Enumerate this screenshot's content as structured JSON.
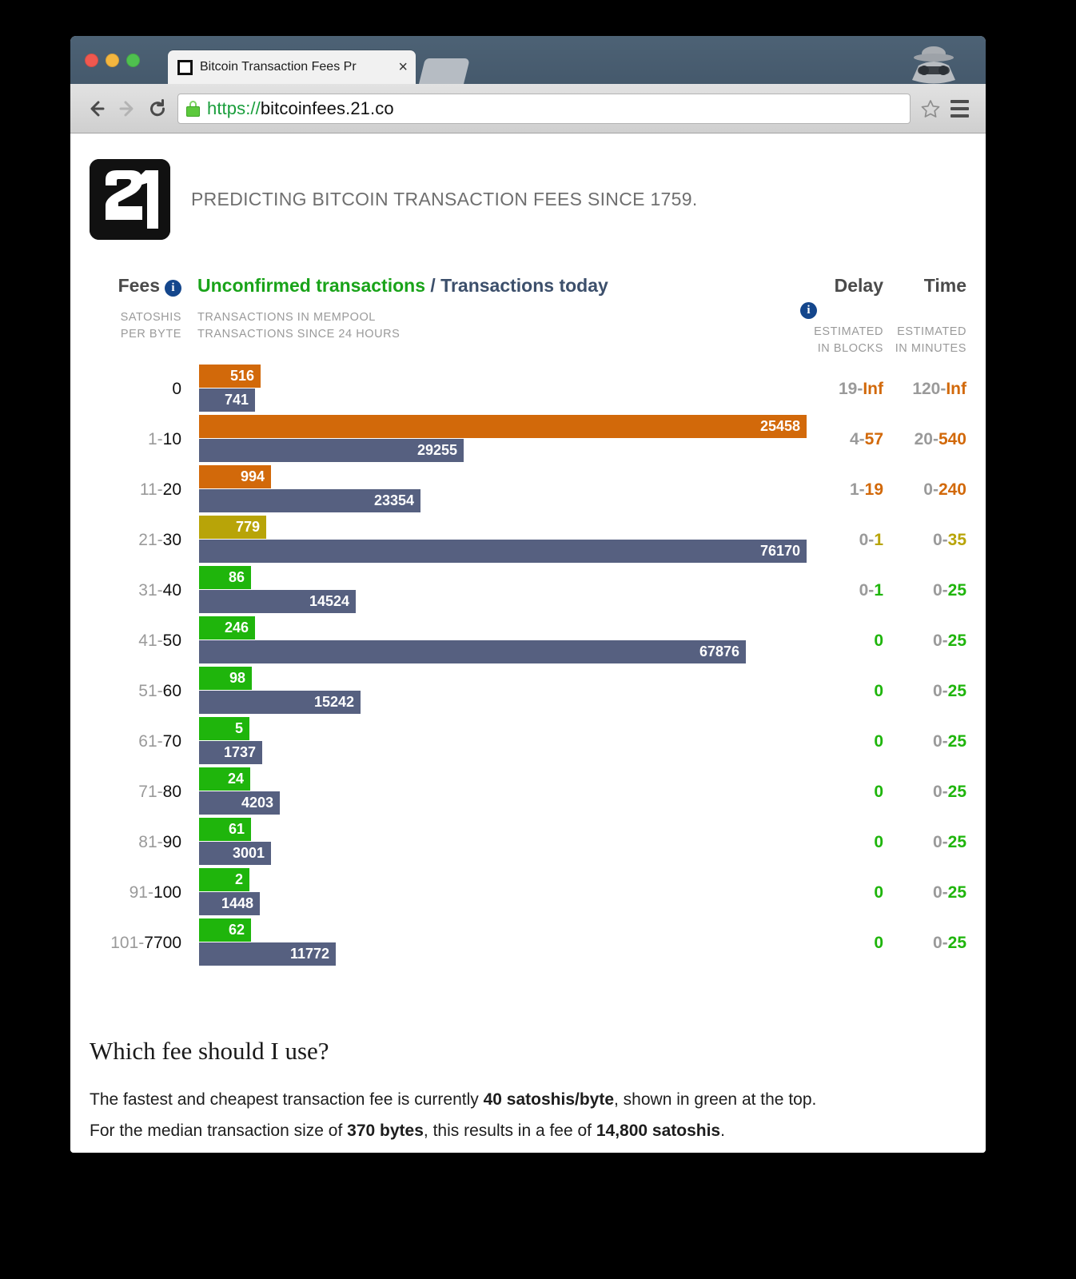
{
  "browser": {
    "tab_title": "Bitcoin Transaction Fees Pr",
    "tab_close_glyph": "×",
    "url_scheme": "https://",
    "url_host": "bitcoinfees.21.co",
    "back_label": "Back",
    "forward_label": "Forward",
    "reload_label": "Reload",
    "bookmark_label": "Bookmark this page",
    "menu_label": "Customize and control",
    "incognito_label": "Incognito mode"
  },
  "site": {
    "logo_text": "21",
    "tagline": "PREDICTING BITCOIN TRANSACTION FEES SINCE 1759."
  },
  "headers": {
    "fees": "Fees",
    "unconfirmed": "Unconfirmed transactions",
    "separator": " / ",
    "today": "Transactions today",
    "delay": "Delay",
    "time": "Time",
    "fees_sub_1": "SATOSHIS",
    "fees_sub_2": "PER BYTE",
    "chart_sub_1": "TRANSACTIONS IN MEMPOOL",
    "chart_sub_2": "TRANSACTIONS SINCE 24 HOURS",
    "delay_sub_1": "ESTIMATED",
    "delay_sub_2": "IN BLOCKS",
    "time_sub_1": "ESTIMATED",
    "time_sub_2": "IN MINUTES"
  },
  "colors": {
    "orange": "#d2690a",
    "olive": "#b8a408",
    "green": "#1fb50c",
    "slate": "#566080",
    "gray": "#9a9a9a",
    "brand_blue": "#14468c"
  },
  "chart_data": {
    "type": "bar",
    "title": "Unconfirmed transactions / Transactions today",
    "xlabel": "",
    "ylabel": "Satoshis per byte",
    "grid": false,
    "legend": [
      "Transactions in mempool",
      "Transactions since 24 hours"
    ],
    "categories": [
      "0",
      "1-10",
      "11-20",
      "21-30",
      "31-40",
      "41-50",
      "51-60",
      "61-70",
      "71-80",
      "81-90",
      "91-100",
      "101-7700"
    ],
    "series": [
      {
        "name": "Transactions in mempool",
        "values": [
          516,
          25458,
          994,
          779,
          86,
          246,
          98,
          5,
          24,
          61,
          2,
          62
        ],
        "max": 25458
      },
      {
        "name": "Transactions since 24 hours",
        "values": [
          741,
          29255,
          23354,
          76170,
          14524,
          67876,
          15242,
          1737,
          4203,
          3001,
          1448,
          11772
        ],
        "max": 76170
      }
    ]
  },
  "rows": [
    {
      "fee_lead": "",
      "fee_tail": "0",
      "mempool": "516",
      "mempool_color": "#d2690a",
      "mempool_value": 516,
      "daily": "741",
      "daily_value": 741,
      "delay_lo": "19-",
      "delay_hi": "Inf",
      "delay_color": "#d2690a",
      "time_lo": "120-",
      "time_hi": "Inf",
      "time_color": "#d2690a"
    },
    {
      "fee_lead": "1-",
      "fee_tail": "10",
      "mempool": "25458",
      "mempool_color": "#d2690a",
      "mempool_value": 25458,
      "daily": "29255",
      "daily_value": 29255,
      "delay_lo": "4-",
      "delay_hi": "57",
      "delay_color": "#d2690a",
      "time_lo": "20-",
      "time_hi": "540",
      "time_color": "#d2690a"
    },
    {
      "fee_lead": "11-",
      "fee_tail": "20",
      "mempool": "994",
      "mempool_color": "#d2690a",
      "mempool_value": 994,
      "daily": "23354",
      "daily_value": 23354,
      "delay_lo": "1-",
      "delay_hi": "19",
      "delay_color": "#d2690a",
      "time_lo": "0-",
      "time_hi": "240",
      "time_color": "#d2690a"
    },
    {
      "fee_lead": "21-",
      "fee_tail": "30",
      "mempool": "779",
      "mempool_color": "#b8a408",
      "mempool_value": 779,
      "daily": "76170",
      "daily_value": 76170,
      "delay_lo": "0-",
      "delay_hi": "1",
      "delay_color": "#b8a408",
      "time_lo": "0-",
      "time_hi": "35",
      "time_color": "#b8a408"
    },
    {
      "fee_lead": "31-",
      "fee_tail": "40",
      "mempool": "86",
      "mempool_color": "#1fb50c",
      "mempool_value": 86,
      "daily": "14524",
      "daily_value": 14524,
      "delay_lo": "0-",
      "delay_hi": "1",
      "delay_color": "#1fb50c",
      "time_lo": "0-",
      "time_hi": "25",
      "time_color": "#1fb50c"
    },
    {
      "fee_lead": "41-",
      "fee_tail": "50",
      "mempool": "246",
      "mempool_color": "#1fb50c",
      "mempool_value": 246,
      "daily": "67876",
      "daily_value": 67876,
      "delay_lo": "",
      "delay_hi": "0",
      "delay_color": "#1fb50c",
      "time_lo": "0-",
      "time_hi": "25",
      "time_color": "#1fb50c"
    },
    {
      "fee_lead": "51-",
      "fee_tail": "60",
      "mempool": "98",
      "mempool_color": "#1fb50c",
      "mempool_value": 98,
      "daily": "15242",
      "daily_value": 15242,
      "delay_lo": "",
      "delay_hi": "0",
      "delay_color": "#1fb50c",
      "time_lo": "0-",
      "time_hi": "25",
      "time_color": "#1fb50c"
    },
    {
      "fee_lead": "61-",
      "fee_tail": "70",
      "mempool": "5",
      "mempool_color": "#1fb50c",
      "mempool_value": 5,
      "daily": "1737",
      "daily_value": 1737,
      "delay_lo": "",
      "delay_hi": "0",
      "delay_color": "#1fb50c",
      "time_lo": "0-",
      "time_hi": "25",
      "time_color": "#1fb50c"
    },
    {
      "fee_lead": "71-",
      "fee_tail": "80",
      "mempool": "24",
      "mempool_color": "#1fb50c",
      "mempool_value": 24,
      "daily": "4203",
      "daily_value": 4203,
      "delay_lo": "",
      "delay_hi": "0",
      "delay_color": "#1fb50c",
      "time_lo": "0-",
      "time_hi": "25",
      "time_color": "#1fb50c"
    },
    {
      "fee_lead": "81-",
      "fee_tail": "90",
      "mempool": "61",
      "mempool_color": "#1fb50c",
      "mempool_value": 61,
      "daily": "3001",
      "daily_value": 3001,
      "delay_lo": "",
      "delay_hi": "0",
      "delay_color": "#1fb50c",
      "time_lo": "0-",
      "time_hi": "25",
      "time_color": "#1fb50c"
    },
    {
      "fee_lead": "91-",
      "fee_tail": "100",
      "mempool": "2",
      "mempool_color": "#1fb50c",
      "mempool_value": 2,
      "daily": "1448",
      "daily_value": 1448,
      "delay_lo": "",
      "delay_hi": "0",
      "delay_color": "#1fb50c",
      "time_lo": "0-",
      "time_hi": "25",
      "time_color": "#1fb50c"
    },
    {
      "fee_lead": "101-",
      "fee_tail": "7700",
      "mempool": "62",
      "mempool_color": "#1fb50c",
      "mempool_value": 62,
      "daily": "11772",
      "daily_value": 11772,
      "delay_lo": "",
      "delay_hi": "0",
      "delay_color": "#1fb50c",
      "time_lo": "0-",
      "time_hi": "25",
      "time_color": "#1fb50c"
    }
  ],
  "footer": {
    "heading": "Which fee should I use?",
    "line1_a": "The fastest and cheapest transaction fee is currently ",
    "line1_b": "40 satoshis/byte",
    "line1_c": ", shown in green at the top.",
    "line2_a": "For the median transaction size of ",
    "line2_b": "370 bytes",
    "line2_c": ", this results in a fee of ",
    "line2_d": "14,800 satoshis",
    "line2_e": "."
  }
}
